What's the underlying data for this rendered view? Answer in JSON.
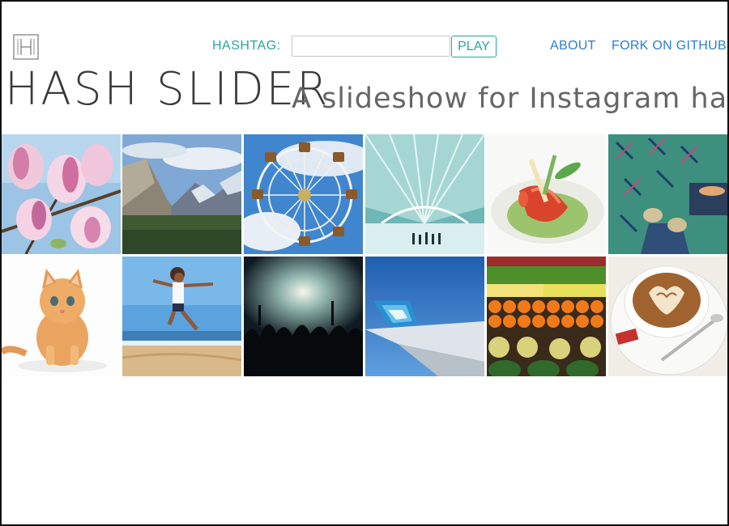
{
  "header": {
    "logo_icon": "hash-slider-logo-icon",
    "hashtag_label": "HASHTAG:",
    "hashtag_value": "",
    "hashtag_placeholder": "",
    "play_label": "PLAY",
    "nav": [
      {
        "label": "ABOUT"
      },
      {
        "label": "FORK ON GITHUB"
      }
    ],
    "title": "HASH SLIDER",
    "tagline": "A slideshow for Instagram hashtags"
  },
  "colors": {
    "accent_teal": "#27a796",
    "link_blue": "#2a7ed3"
  },
  "grid": {
    "tiles": [
      {
        "subject": "magnolia-blossoms-photo"
      },
      {
        "subject": "valley-mountains-photo"
      },
      {
        "subject": "ferris-wheel-photo"
      },
      {
        "subject": "white-architecture-hall-photo"
      },
      {
        "subject": "plated-lobster-dish-photo"
      },
      {
        "subject": "patterned-carpet-feet-photo"
      },
      {
        "subject": "orange-kitten-photo"
      },
      {
        "subject": "beach-jump-photo"
      },
      {
        "subject": "concert-crowd-photo"
      },
      {
        "subject": "airplane-wing-photo"
      },
      {
        "subject": "fruit-market-photo"
      },
      {
        "subject": "latte-art-photo"
      }
    ]
  }
}
